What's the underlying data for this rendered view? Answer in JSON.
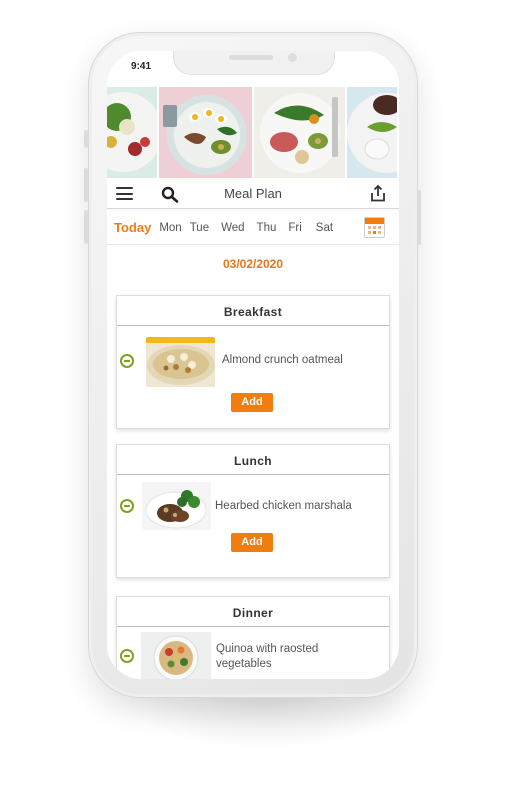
{
  "status_bar": {
    "time": "9:41"
  },
  "header": {
    "title": "Meal Plan",
    "menu_icon": "hamburger-menu-icon",
    "search_icon": "search-icon",
    "share_icon": "share-icon"
  },
  "week": {
    "days": [
      "Today",
      "Mon",
      "Tue",
      "Wed",
      "Thu",
      "Fri",
      "Sat"
    ],
    "selected": "Today",
    "calendar_icon": "calendar-icon"
  },
  "date": "03/02/2020",
  "meals": {
    "breakfast": {
      "title": "Breakfast",
      "item": "Almond crunch oatmeal",
      "add_label": "Add"
    },
    "lunch": {
      "title": "Lunch",
      "item": "Hearbed chicken marshala",
      "add_label": "Add"
    },
    "dinner": {
      "title": "Dinner",
      "item_line1": "Quinoa with raosted",
      "item_line2": "vegetables"
    }
  },
  "colors": {
    "accent": "#f07d10",
    "date": "#e8751a",
    "remove": "#7fa11e"
  }
}
